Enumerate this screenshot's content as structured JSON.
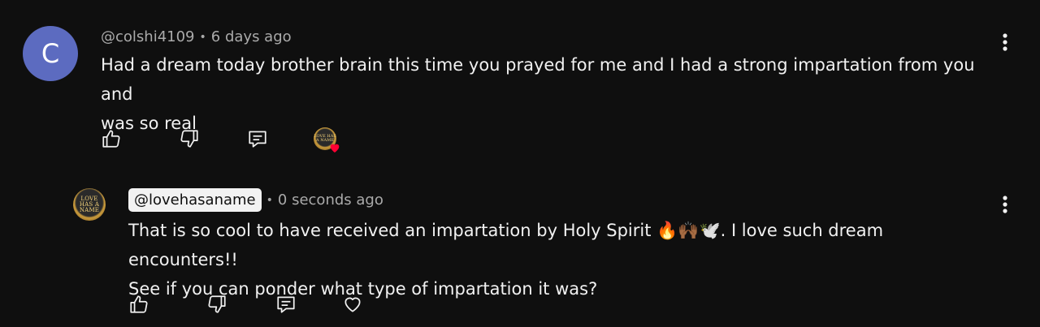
{
  "comment": {
    "avatar_letter": "C",
    "handle": "@colshi4109",
    "separator": "•",
    "time": "6 days ago",
    "text_line1": "Had a dream today brother brain this time you prayed for me and I had a strong impartation from you and",
    "text_line2": "was so real",
    "actions": [
      "like-icon",
      "dislike-icon",
      "reply-icon"
    ],
    "creator_heart": {
      "avatar_text": "LOVE HAS A NAME",
      "heart_color": "#ff0033"
    }
  },
  "reply": {
    "avatar_text": "LOVE HAS A NAME",
    "handle": "@lovehasaname",
    "separator": "•",
    "time": "0 seconds ago",
    "text_line1": "That is so cool to have received an impartation by Holy Spirit 🔥🙌🏾🕊️. I love such dream encounters!!",
    "text_line2": "See if you can ponder what type of impartation it was?",
    "actions": [
      "like-icon",
      "dislike-icon",
      "reply-icon",
      "heart-icon"
    ]
  },
  "colors": {
    "background": "#0f0f0f",
    "text_primary": "#f1f1f1",
    "text_secondary": "#aaaaaa",
    "avatar_letter_bg": "#5c6bc0"
  }
}
